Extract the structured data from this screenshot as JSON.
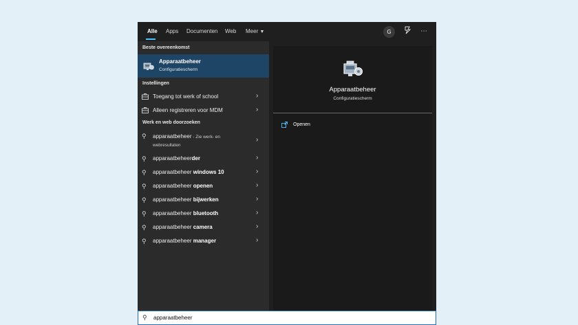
{
  "tabs": [
    {
      "label": "Alle",
      "active": true
    },
    {
      "label": "Apps"
    },
    {
      "label": "Documenten"
    },
    {
      "label": "Web"
    },
    {
      "label": "Meer"
    }
  ],
  "user": {
    "avatar_letter": "G"
  },
  "sections": {
    "best_match": "Beste overeenkomst",
    "settings": "Instellingen",
    "web": "Werk en web doorzoeken"
  },
  "best_match": {
    "title": "Apparaatbeheer",
    "subtitle": "Configuratiescherm",
    "icon": "device-manager-icon"
  },
  "settings_items": [
    {
      "label": "Toegang tot werk of school",
      "icon": "briefcase-icon"
    },
    {
      "label": "Alleen registreren voor MDM",
      "icon": "briefcase-icon"
    }
  ],
  "web_items": [
    {
      "prefix": "apparaatbeheer",
      "bold": "",
      "sub": " - Zie werk- en webresultaten"
    },
    {
      "prefix": "apparaatbeheer",
      "bold": "der",
      "sub": ""
    },
    {
      "prefix": "apparaatbeheer ",
      "bold": "windows 10",
      "sub": ""
    },
    {
      "prefix": "apparaatbeheer ",
      "bold": "openen",
      "sub": ""
    },
    {
      "prefix": "apparaatbeheer ",
      "bold": "bijwerken",
      "sub": ""
    },
    {
      "prefix": "apparaatbeheer ",
      "bold": "bluetooth",
      "sub": ""
    },
    {
      "prefix": "apparaatbeheer ",
      "bold": "camera",
      "sub": ""
    },
    {
      "prefix": "apparaatbeheer ",
      "bold": "manager",
      "sub": ""
    }
  ],
  "preview": {
    "title": "Apparaatbeheer",
    "subtitle": "Configuratiescherm",
    "actions": [
      {
        "label": "Openen",
        "icon": "open-window-icon"
      }
    ]
  },
  "search": {
    "value": "apparaatbeheer"
  },
  "colors": {
    "accent": "#4cc2ff",
    "selected": "#1f4566"
  }
}
